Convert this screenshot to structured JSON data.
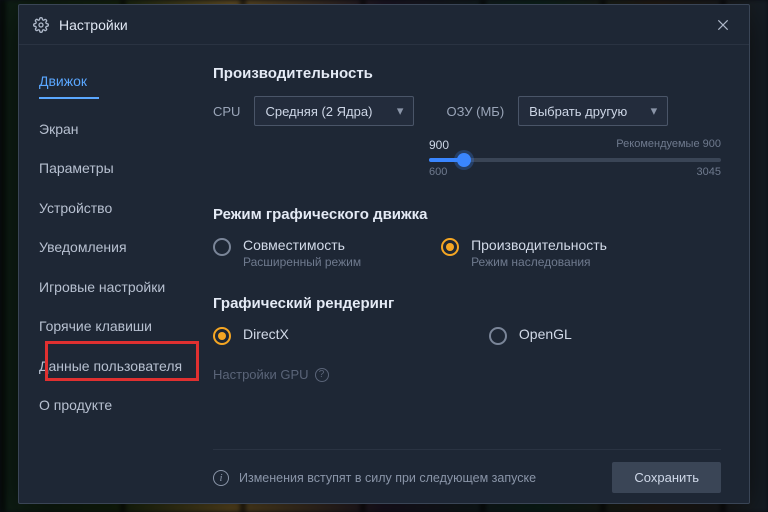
{
  "window": {
    "title": "Настройки"
  },
  "sidebar": {
    "items": [
      {
        "label": "Движок"
      },
      {
        "label": "Экран"
      },
      {
        "label": "Параметры"
      },
      {
        "label": "Устройство"
      },
      {
        "label": "Уведомления"
      },
      {
        "label": "Игровые настройки"
      },
      {
        "label": "Горячие клавиши"
      },
      {
        "label": "Данные пользователя"
      },
      {
        "label": "О продукте"
      }
    ],
    "active_index": 0,
    "highlighted_index": 6
  },
  "perf": {
    "heading": "Производительность",
    "cpu_label": "CPU",
    "cpu_value": "Средняя (2 Ядра)",
    "ram_label": "ОЗУ (МБ)",
    "ram_value": "Выбрать другую",
    "slider": {
      "value": "900",
      "recommended": "Рекомендуемые 900",
      "min": "600",
      "max": "3045"
    }
  },
  "engine_mode": {
    "heading": "Режим графического движка",
    "opt1": {
      "title": "Совместимость",
      "sub": "Расширенный режим"
    },
    "opt2": {
      "title": "Производительность",
      "sub": "Режим наследования"
    },
    "selected": "opt2"
  },
  "rendering": {
    "heading": "Графический рендеринг",
    "opt1": "DirectX",
    "opt2": "OpenGL",
    "selected": "opt1"
  },
  "gpu_settings_label": "Настройки GPU",
  "footer": {
    "message": "Изменения вступят в силу при следующем запуске",
    "save": "Сохранить"
  },
  "colors": {
    "accent_blue": "#3a86ff",
    "accent_orange": "#f5a623",
    "highlight_red": "#e03030"
  }
}
